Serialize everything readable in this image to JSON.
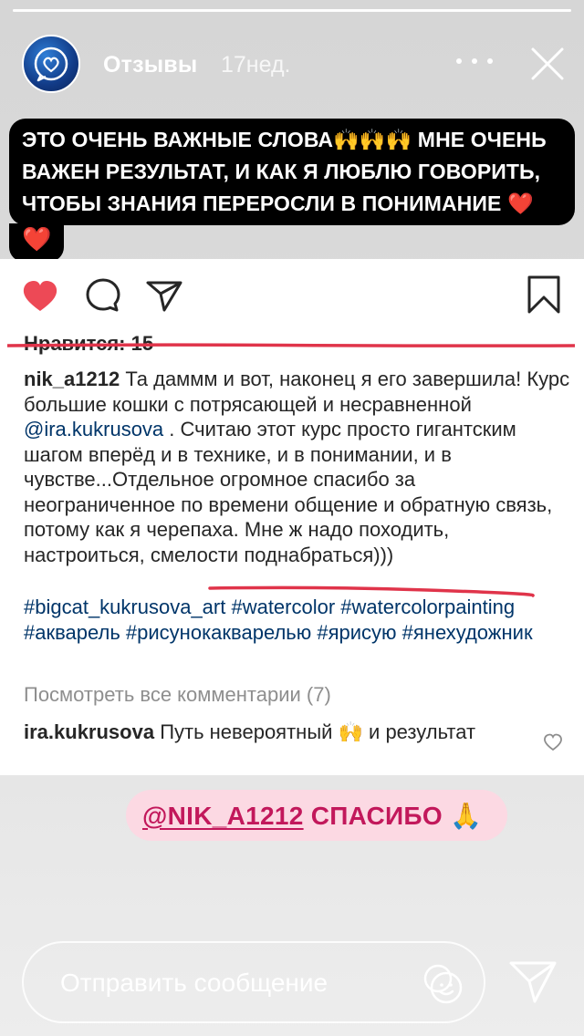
{
  "story": {
    "progress_fraction": 1.0,
    "title": "Отзывы",
    "time_ago": "17нед.",
    "more_icon": "more-horizontal-icon",
    "close_icon": "close-icon"
  },
  "caption": {
    "text": "ЭТО ОЧЕНЬ ВАЖНЫЕ СЛОВА🙌🙌🙌 МНЕ ОЧЕНЬ ВАЖЕН РЕЗУЛЬТАТ, И КАК Я ЛЮБЛЮ ГОВОРИТЬ, ЧТОБЫ ЗНАНИЯ ПЕРЕРОСЛИ В ПОНИМАНИЕ ❤️",
    "tail": "❤️"
  },
  "post": {
    "likes": "Нравится: 15",
    "comment_user": "nik_a1212",
    "comment_part1": " Та даммм и вот, наконец я его завершила! Курс большие кошки с потрясающей и несравненной ",
    "comment_mention": "@ira.kukrusova",
    "comment_part2": " . Считаю этот курс просто гигантским шагом вперёд и в технике, и в понимании, и в чувстве...Отдельное огромное спасибо за неограниченное по времени общение и обратную связь, потому как я черепаха. Мне ж надо походить, настроиться, смелости поднабраться)))",
    "hashtags": "#bigcat_kukrusova_art #watercolor #watercolorpainting #акварель #рисунокакварелью #ярисую #янехудожник",
    "view_all": "Посмотреть все комментарии (7)",
    "reply_user": "ira.kukrusova",
    "reply_text": " Путь невероятный 🙌 и результат"
  },
  "sticker": {
    "mention": "@NIK_A1212",
    "text": " СПАСИБО 🙏"
  },
  "bottom": {
    "message_placeholder": "Отправить сообщение"
  },
  "colors": {
    "like_red": "#ed4956",
    "annotation_red": "#e0344a",
    "sticker_pink": "#c2185b",
    "link_blue": "#003569"
  }
}
